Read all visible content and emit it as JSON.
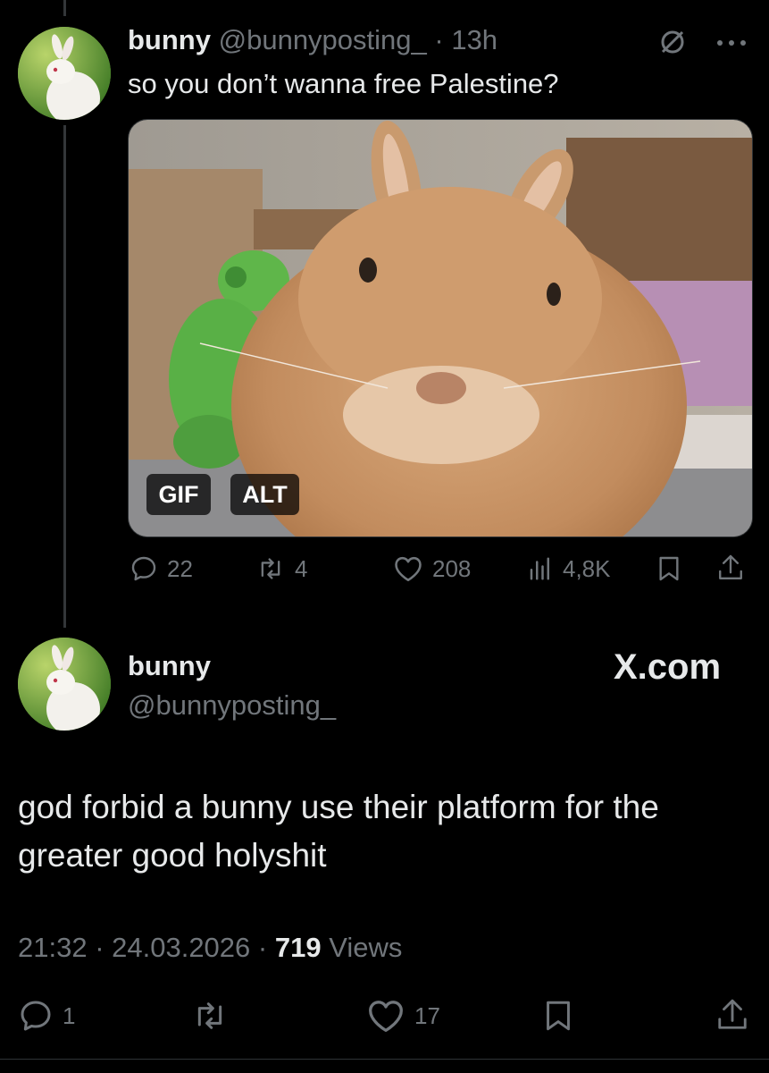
{
  "reply_tweet": {
    "display_name": "bunny",
    "handle": "@bunnyposting_",
    "time": "· 13h",
    "text": "so you don’t wanna free Palestine?",
    "media_badges": {
      "gif": "GIF",
      "alt": "ALT"
    },
    "actions": {
      "replies": "22",
      "reposts": "4",
      "likes": "208",
      "views": "4,8K"
    }
  },
  "main_tweet": {
    "display_name": "bunny",
    "handle": "@bunnyposting_",
    "brand": "X.com",
    "text_line1": "god forbid a bunny use their platform for the",
    "text_line2": "greater good holyshit",
    "timestamp": "21:32 · 24.03.2026 ·",
    "views_count": "719",
    "views_label": "Views",
    "actions": {
      "replies": "1",
      "likes": "17"
    }
  },
  "colors": {
    "background": "#000000",
    "text": "#e7e9ea",
    "muted": "#71767b",
    "divider": "#2f3336"
  },
  "icons": [
    "bunny-avatar",
    "no-entry-icon",
    "more-icon",
    "reply-icon",
    "repost-icon",
    "like-icon",
    "views-icon",
    "bookmark-icon",
    "share-icon"
  ]
}
